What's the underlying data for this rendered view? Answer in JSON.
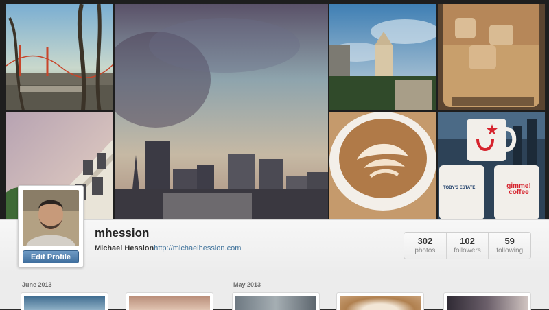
{
  "profile": {
    "username": "mhession",
    "full_name": "Michael Hession",
    "website": "http://michaelhession.com",
    "edit_label": "Edit Profile"
  },
  "stats": [
    {
      "value": "302",
      "label": "photos"
    },
    {
      "value": "102",
      "label": "followers"
    },
    {
      "value": "59",
      "label": "following"
    }
  ],
  "feed": {
    "months": [
      "June 2013",
      "May 2013"
    ]
  },
  "mosaic": {
    "tiles": [
      "golden-gate-bridge-photo",
      "city-skyline-sunset-photo",
      "clock-tower-photo",
      "iced-coffee-photo",
      "pastel-building-photo",
      "latte-art-photo",
      "coffee-mugs-photo"
    ],
    "mug_labels": [
      "TOBY'S ESTATE",
      "gimme! coffee"
    ]
  },
  "colors": {
    "link": "#3f729b",
    "button": "#4f7fae"
  }
}
